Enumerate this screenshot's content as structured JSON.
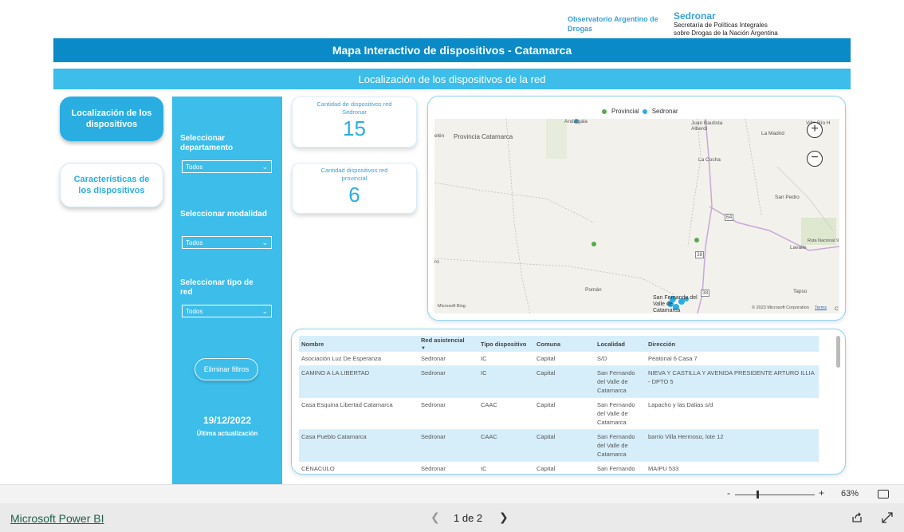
{
  "header": {
    "obs_logo": "Observatorio Argentino de Drogas",
    "sedronar_name": "Sedronar",
    "sedronar_sub1": "Secretaría de Políticas Integrales",
    "sedronar_sub2": "sobre Drogas de la Nación Argentina",
    "title": "Mapa Interactivo de dispositivos - Catamarca",
    "subtitle": "Localización de los dispositivos de la red"
  },
  "nav": {
    "localizacion": "Localización de los dispositivos",
    "caracteristicas": "Características de los dispositivos"
  },
  "filters": {
    "departamento_label": "Seleccionar departamento",
    "departamento_value": "Todos",
    "modalidad_label": "Seleccionar modalidad",
    "modalidad_value": "Todos",
    "tipo_red_label": "Seleccionar tipo de red",
    "tipo_red_value": "Todos",
    "clear_label": "Eliminar filtros",
    "date": "19/12/2022",
    "date_label": "Última actualización"
  },
  "kpis": {
    "sedronar_title": "Cantidad de dispositivos red Sedronar",
    "sedronar_value": "15",
    "provincial_title": "Cantidad dispositivos red provincial",
    "provincial_value": "6"
  },
  "map": {
    "legend_provincial": "Provincial",
    "legend_sedronar": "Sedronar",
    "colors": {
      "provincial": "#5aa84e",
      "sedronar": "#2aaee2"
    },
    "labels": {
      "andalgala": "Andalgala",
      "provincia": "Provincia Catamarca",
      "alberdi": "Juan Bautista Alberdi",
      "la_madrid": "La Madrid",
      "villa_rio": "Villa Río H",
      "la_cocha": "La Cocha",
      "san_pedro": "San Pedro",
      "lavalle": "Lavalle",
      "ruta": "Ruta Nacional 9",
      "pomán": "Pomán",
      "tapso": "Tapso",
      "sfvc": "San Fernando del Valle de Catamarca",
      "belen": "elén",
      "ro": "ro",
      "r64": "64",
      "r38": "38",
      "r38b": "38",
      "msbing": "Microsoft Bing",
      "copyright": "© 2023 Microsoft Corporation",
      "terms": "Terms",
      "c": "C"
    }
  },
  "table": {
    "headers": [
      "Nombre",
      "Red asistencial",
      "Tipo dispositivo",
      "Comuna",
      "Localidad",
      "Dirección"
    ],
    "rows": [
      [
        "Asociación Luz De Esperanza",
        "Sedronar",
        "IC",
        "Capital",
        "S/D",
        "Peatonal 6 Casa 7"
      ],
      [
        "CAMINO A LA LIBERTAD",
        "Sedronar",
        "IC",
        "Capital",
        "San Fernando del Valle de Catamarca",
        "NIEVA Y CASTILLA Y AVENIDA PRESIDENTE ARTURO ILLIA - DPTO 5"
      ],
      [
        "Casa Esquina Libertad Catamarca",
        "Sedronar",
        "CAAC",
        "Capital",
        "San Fernando del Valle de Catamarca",
        "Lapacho y las Dalias s/d"
      ],
      [
        "Casa Pueblo Catamarca",
        "Sedronar",
        "CAAC",
        "Capital",
        "San Fernando del Valle de Catamarca",
        "barrio Villa Hermoso, lote 12"
      ],
      [
        "CENACULO",
        "Sedronar",
        "IC",
        "Capital",
        "San Fernando del Valle de",
        "MAIPU 533"
      ]
    ]
  },
  "zoom": {
    "minus": "-",
    "plus": "+",
    "percent": "63%",
    "level": 0.27
  },
  "footer": {
    "brand": "Microsoft Power BI",
    "page_indicator": "1 de 2"
  }
}
